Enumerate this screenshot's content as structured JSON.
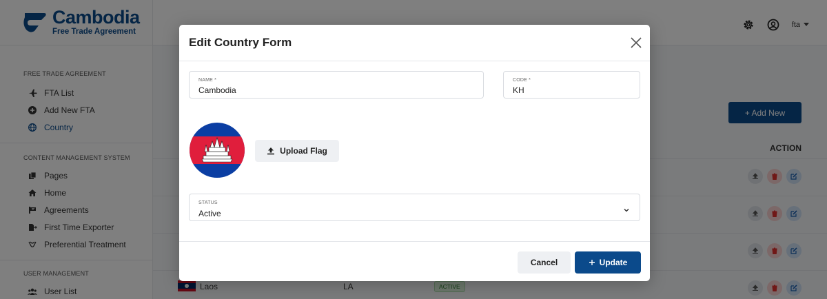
{
  "app": {
    "logo_title": "Cambodia",
    "logo_subtitle": "Free Trade Agreement",
    "brand_color": "#0b4a8b"
  },
  "sidebar": {
    "sections": [
      {
        "title": "FREE TRADE AGREEMENT",
        "items": [
          {
            "label": "FTA List",
            "icon": "plane-icon"
          },
          {
            "label": "Add New FTA",
            "icon": "plus-circle-icon"
          },
          {
            "label": "Country",
            "icon": "globe-icon",
            "active": true
          }
        ]
      },
      {
        "title": "CONTENT MANAGEMENT SYSTEM",
        "items": [
          {
            "label": "Pages",
            "icon": "pages-icon"
          },
          {
            "label": "Home",
            "icon": "home-icon"
          },
          {
            "label": "Agreements",
            "icon": "agreements-icon"
          },
          {
            "label": "First Time Exporter",
            "icon": "exporter-icon"
          },
          {
            "label": "Preferential Treatment",
            "icon": "treatment-icon"
          }
        ]
      },
      {
        "title": "USER MANAGEMENT",
        "items": [
          {
            "label": "User List",
            "icon": "users-icon"
          }
        ]
      }
    ]
  },
  "topbar": {
    "user_name": "fta"
  },
  "main": {
    "add_new_label": "+ Add New",
    "action_header": "ACTION",
    "visible_row": {
      "name": "Laos",
      "code": "LA",
      "status": "ACTIVE"
    }
  },
  "modal": {
    "title": "Edit Country Form",
    "name_label": "NAME *",
    "name_value": "Cambodia",
    "code_label": "CODE *",
    "code_value": "KH",
    "upload_label": "Upload Flag",
    "status_label": "STATUS",
    "status_value": "Active",
    "cancel_label": "Cancel",
    "update_label": "Update"
  },
  "colors": {
    "primary": "#0b4a8b",
    "flag_blue": "#0b3ea3",
    "flag_red": "#e01e3c",
    "active_green": "#2e7d32"
  }
}
